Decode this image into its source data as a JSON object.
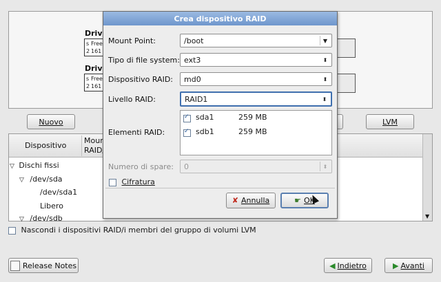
{
  "background": {
    "drive1_label": "Drive",
    "drive2_label": "Drive",
    "drive_cells": [
      "s",
      "2",
      "Free",
      "161"
    ],
    "buttons": {
      "new": "Nuovo",
      "lvm": "LVM"
    },
    "table": {
      "col_device": "Dispositivo",
      "col_mount": "Moun",
      "col_mount2": "RAID/"
    },
    "tree": [
      "Dischi fissi",
      "/dev/sda",
      "/dev/sda1",
      "Libero",
      "/dev/sdb"
    ],
    "hide_raid_label": "Nascondi i dispositivi RAID/i membri del gruppo di volumi LVM",
    "release_notes": "Release Notes",
    "back": "Indietro",
    "next": "Avanti"
  },
  "dialog": {
    "title": "Crea dispositivo RAID",
    "mount_label": "Mount Point:",
    "mount_value": "/boot",
    "fs_label": "Tipo di file system:",
    "fs_value": "ext3",
    "device_label": "Dispositivo RAID:",
    "device_value": "md0",
    "level_label": "Livello RAID:",
    "level_value": "RAID1",
    "members_label": "Elementi RAID:",
    "members": [
      {
        "name": "sda1",
        "size": "259 MB",
        "checked": true
      },
      {
        "name": "sdb1",
        "size": "259 MB",
        "checked": true
      }
    ],
    "spares_label": "Numero di spare:",
    "spares_value": "0",
    "encrypt_label": "Cifratura",
    "cancel": "Annulla",
    "ok": "OK"
  },
  "colors": {
    "title_bar": "#7a9fd0",
    "selection_border": "#5a7fb0"
  }
}
